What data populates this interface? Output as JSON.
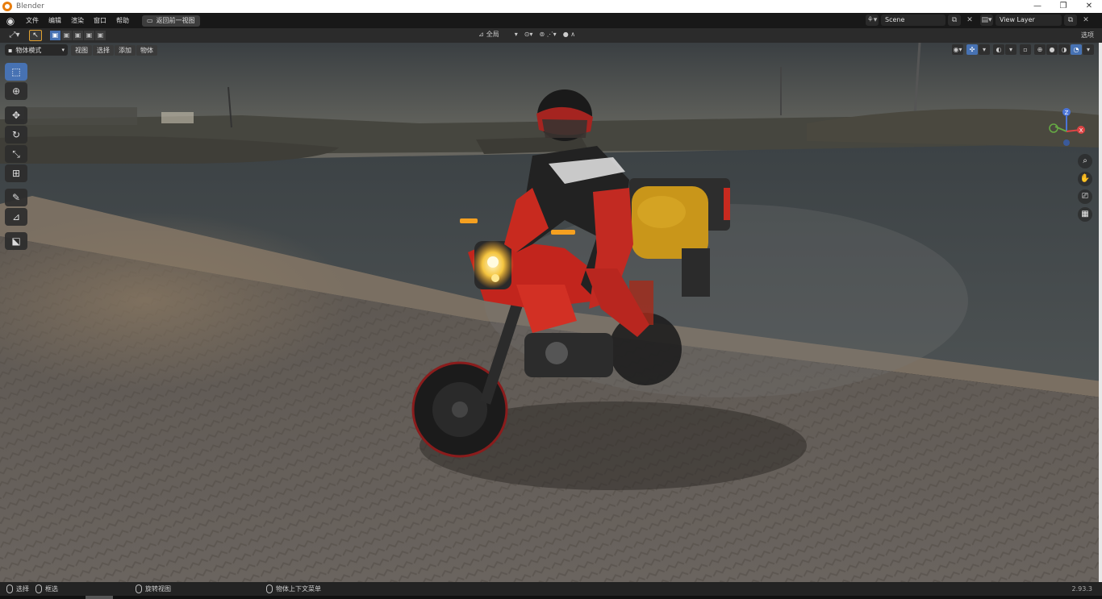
{
  "window": {
    "title": "Blender",
    "minimize": "—",
    "restore": "❐",
    "close": "✕"
  },
  "menubar": {
    "items": [
      "文件",
      "编辑",
      "渲染",
      "窗口",
      "帮助"
    ],
    "back_button": "返回前一视图",
    "scene": "Scene",
    "view_layer": "View Layer"
  },
  "viewport_header": {
    "transform_orientation": "全局",
    "options": "选项"
  },
  "viewport_header2": {
    "mode": "物体模式",
    "menus": [
      "视图",
      "选择",
      "添加",
      "物体"
    ]
  },
  "gizmo": {
    "z": "Z",
    "x": "X"
  },
  "statusbar": {
    "select": "选择",
    "box_select": "框选",
    "rotate_view": "旋转视图",
    "context_menu": "物体上下文菜单",
    "version": "2.93.3"
  },
  "icons": {
    "tools": [
      "cursor-select-icon",
      "cursor-icon",
      "move-icon",
      "rotate-icon",
      "scale-icon",
      "transform-icon",
      "annotate-icon",
      "measure-icon",
      "add-cube-icon"
    ],
    "nav": [
      "zoom-icon",
      "pan-hand-icon",
      "camera-icon",
      "grid-view-icon"
    ]
  },
  "colors": {
    "accent": "#4772b3",
    "brand": "#e87d0d"
  }
}
